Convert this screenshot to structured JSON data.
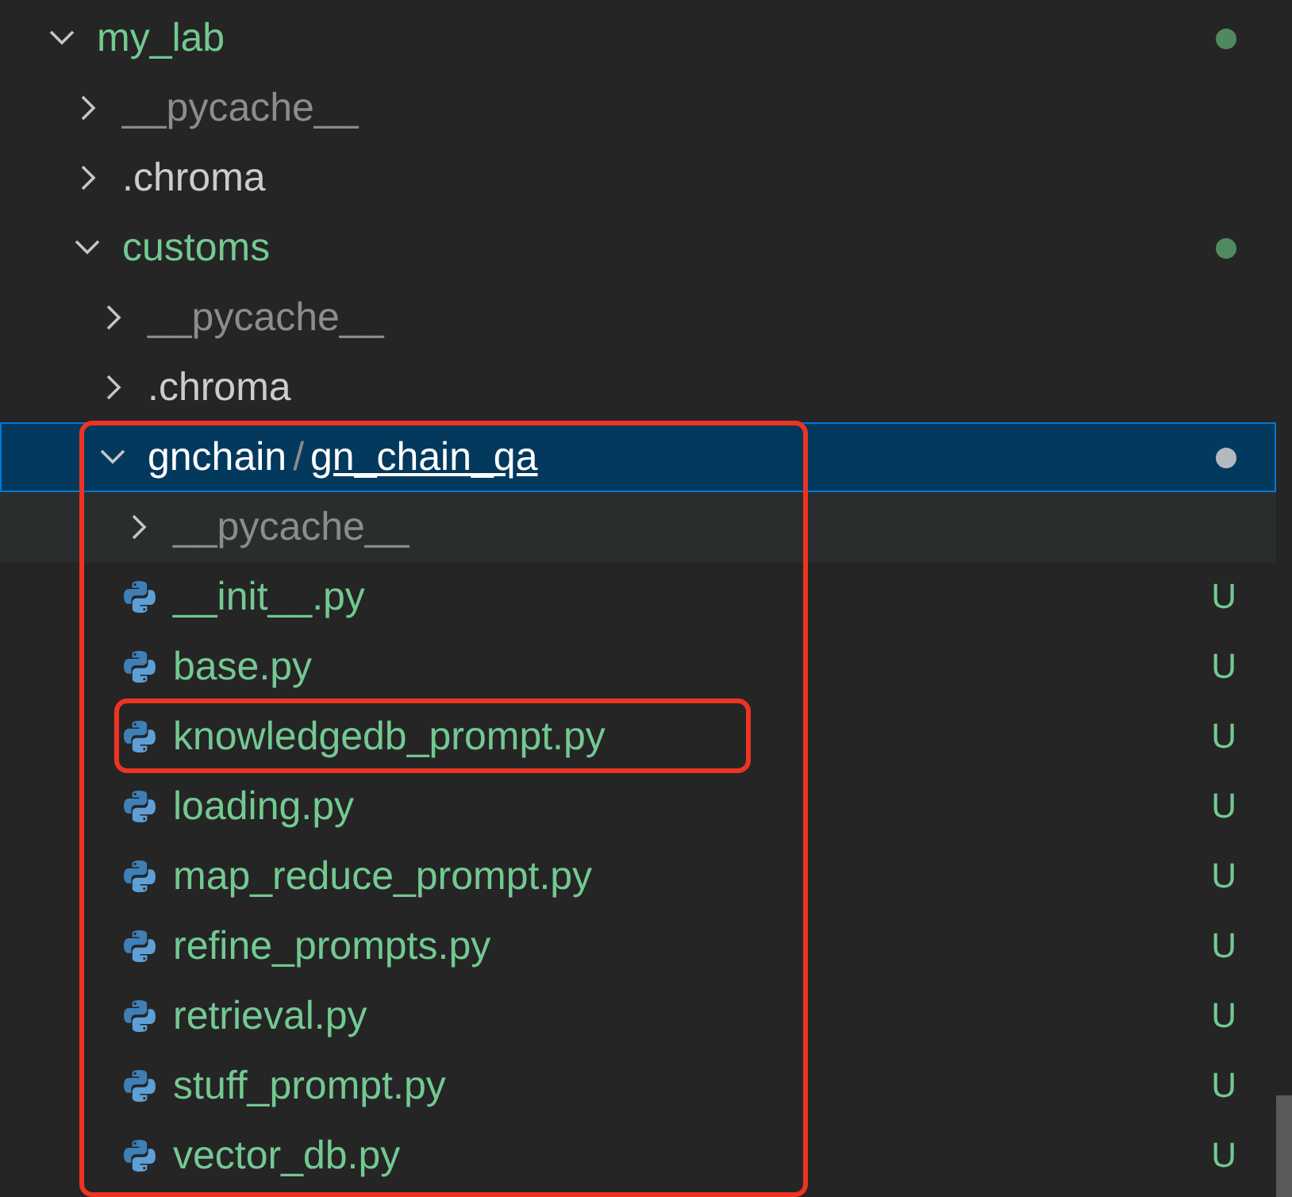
{
  "tree": [
    {
      "kind": "folder",
      "name": "my_lab",
      "expanded": true,
      "selected": false,
      "ignored": false,
      "dot": true,
      "children": [
        {
          "kind": "folder",
          "name": "__pycache__",
          "expanded": false,
          "selected": false,
          "ignored": true
        },
        {
          "kind": "folder",
          "name": ".chroma",
          "expanded": false,
          "selected": false,
          "ignored": false
        },
        {
          "kind": "folder",
          "name": "customs",
          "expanded": true,
          "selected": false,
          "ignored": false,
          "dot": true,
          "children": [
            {
              "kind": "folder",
              "name": "__pycache__",
              "expanded": false,
              "selected": false,
              "ignored": true
            },
            {
              "kind": "folder",
              "name": ".chroma",
              "expanded": false,
              "selected": false,
              "ignored": false
            },
            {
              "kind": "compact",
              "name": "gnchain",
              "separator": "/",
              "focus_name": "gn_chain_qa",
              "expanded": true,
              "selected": true,
              "ignored": false,
              "dot": true,
              "outlined": true,
              "children": [
                {
                  "kind": "folder",
                  "name": "__pycache__",
                  "expanded": false,
                  "selected": false,
                  "hovered": true,
                  "ignored": true
                },
                {
                  "kind": "file",
                  "name": "__init__.py",
                  "badge": "U",
                  "selected": false
                },
                {
                  "kind": "file",
                  "name": "base.py",
                  "badge": "U",
                  "selected": false
                },
                {
                  "kind": "file",
                  "name": "knowledgedb_prompt.py",
                  "badge": "U",
                  "selected": false,
                  "outlined": true
                },
                {
                  "kind": "file",
                  "name": "loading.py",
                  "badge": "U",
                  "selected": false
                },
                {
                  "kind": "file",
                  "name": "map_reduce_prompt.py",
                  "badge": "U",
                  "selected": false
                },
                {
                  "kind": "file",
                  "name": "refine_prompts.py",
                  "badge": "U",
                  "selected": false
                },
                {
                  "kind": "file",
                  "name": "retrieval.py",
                  "badge": "U",
                  "selected": false
                },
                {
                  "kind": "file",
                  "name": "stuff_prompt.py",
                  "badge": "U",
                  "selected": false
                },
                {
                  "kind": "file",
                  "name": "vector_db.py",
                  "badge": "U",
                  "selected": false
                }
              ]
            }
          ]
        }
      ]
    }
  ]
}
